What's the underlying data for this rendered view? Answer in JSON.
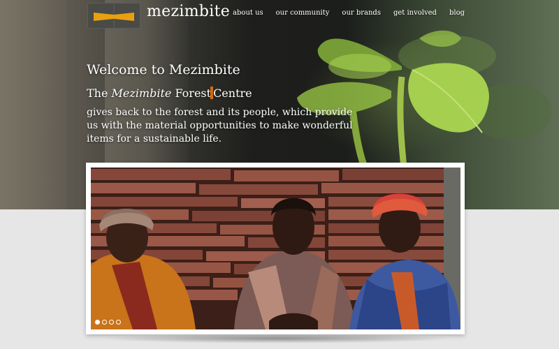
{
  "header": {
    "logo_text": "mezimbite",
    "logo_colors": {
      "box": "#4a4a46",
      "bowtie": "#e8a012"
    },
    "nav": [
      "about us",
      "our community",
      "our brands",
      "get involved",
      "blog"
    ]
  },
  "hero": {
    "welcome": "Welcome to Mezimbite",
    "subtitle_prefix": "The ",
    "subtitle_em": "Mezimbite",
    "subtitle_mid": " Forest",
    "subtitle_suffix": "Centre",
    "tagline": "gives back to the forest and its people, which provide us with the material opportunities to make wonderful items for a sustainable life.",
    "accent_color": "#d46a10"
  },
  "slider": {
    "dots": [
      {
        "active": true
      },
      {
        "active": false
      },
      {
        "active": false
      },
      {
        "active": false
      }
    ]
  }
}
